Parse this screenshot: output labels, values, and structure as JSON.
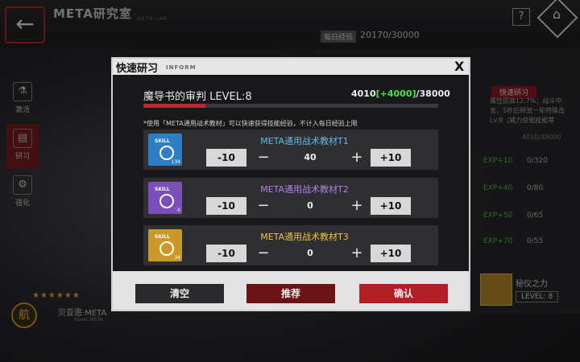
{
  "app": {
    "title": "META研究室",
    "subtitle": "META LAB"
  },
  "header": {
    "help_label": "?",
    "daily_exp_label": "每日经验",
    "daily_exp_value": "20170/30000"
  },
  "side_menu": [
    {
      "icon": "flask-icon",
      "glyph": "⚗",
      "label": "激活"
    },
    {
      "icon": "research-icon",
      "glyph": "▤",
      "label": "研习",
      "active": true
    },
    {
      "icon": "upgrade-icon",
      "glyph": "⚙",
      "label": "强化"
    }
  ],
  "right_panel": {
    "badge": "快速研习",
    "desc": "属性提高12.7%；战斗中发，5秒后释放一轮特殊击Lv.8（威力依据技能等",
    "right_progress": "4010/38000",
    "rows": [
      {
        "exp": "EXP+10",
        "val": "0/320"
      },
      {
        "exp": "EXP+40",
        "val": "0/80"
      },
      {
        "exp": "EXP+50",
        "val": "0/65"
      },
      {
        "exp": "EXP+70",
        "val": "0/55"
      }
    ],
    "skill_name": "秘仪之力",
    "skill_level": "LEVEL: 8"
  },
  "character": {
    "name": "贝亚恩·META",
    "sub": "Bearn.META",
    "stars": "★★★★★★",
    "badge": "航"
  },
  "modal": {
    "title": "快速研习",
    "inform": "INFORM",
    "close": "X",
    "skill_title": "魔导书的审判 LEVEL:8",
    "progress_current": "4010",
    "progress_added": "[+4000]",
    "progress_total": "/38000",
    "progress_fraction": 0.211,
    "note": "*使用「META通用战术教材」可以快速获得技能经验，不计入每日经验上限",
    "items": [
      {
        "name": "META通用战术教材T1",
        "color": "#5fb8e8",
        "book_color": "#2f7ec4",
        "count": "134",
        "qty": "40",
        "book_label": "SKILL"
      },
      {
        "name": "META通用战术教材T2",
        "color": "#b47ee8",
        "book_color": "#7b4fb8",
        "count": "0",
        "qty": "0",
        "book_label": "SKILL"
      },
      {
        "name": "META通用战术教材T3",
        "color": "#f0c23c",
        "book_color": "#c99a2a",
        "count": "34",
        "qty": "0",
        "book_label": "SKILL"
      }
    ],
    "controls": {
      "minus10": "-10",
      "minus": "−",
      "plus": "+",
      "plus10": "+10"
    },
    "footer": {
      "clear": "清空",
      "recommend": "推荐",
      "confirm": "确认"
    }
  }
}
